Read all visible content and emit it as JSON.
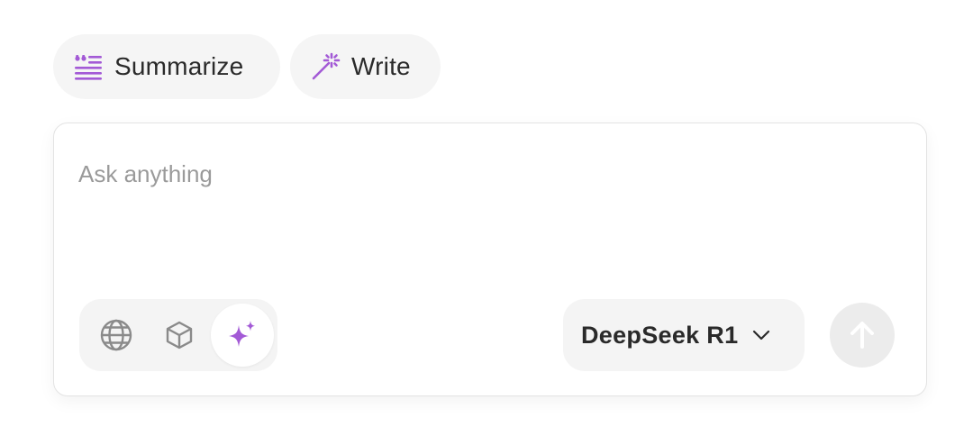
{
  "suggestions": {
    "summarize": {
      "label": "Summarize",
      "icon": "quote-lines-icon"
    },
    "write": {
      "label": "Write",
      "icon": "magic-wand-icon"
    }
  },
  "composer": {
    "placeholder": "Ask anything",
    "value": "",
    "modes": [
      {
        "icon": "globe-icon",
        "active": false
      },
      {
        "icon": "cube-icon",
        "active": false
      },
      {
        "icon": "sparkle-icon",
        "active": true
      }
    ],
    "model": {
      "selected": "DeepSeek R1"
    },
    "send": {
      "icon": "arrow-up-icon",
      "enabled": false
    }
  },
  "colors": {
    "accent": "#a35ad6",
    "chip_bg": "#f5f5f5",
    "text": "#2a2a2a",
    "placeholder": "#9a9a9a",
    "icon_gray": "#8a8a8a",
    "send_disabled_bg": "#ececec"
  }
}
